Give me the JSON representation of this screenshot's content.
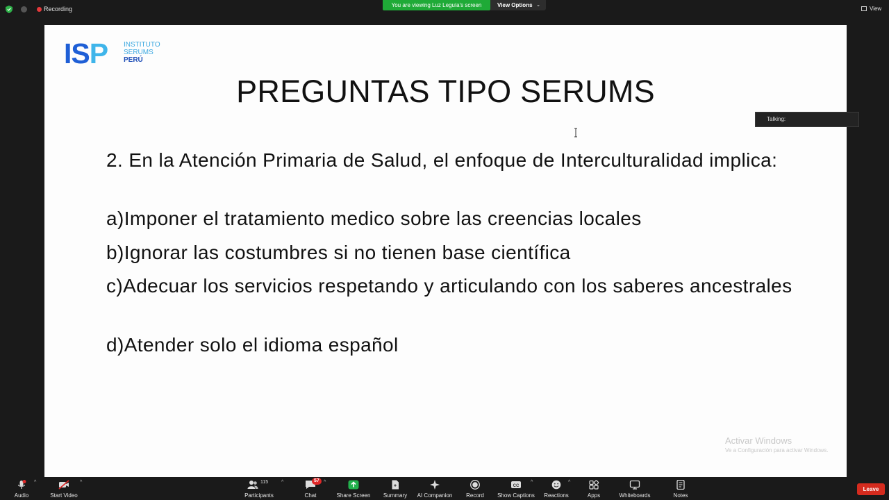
{
  "topbar": {
    "recording_label": "Recording",
    "viewing_banner": "You are viewing Luz Leguía's screen",
    "view_options_label": "View Options",
    "view_label": "View"
  },
  "slide": {
    "logo_text_main": "ISP",
    "logo_line1": "INSTITUTO",
    "logo_line2": "SERUMS",
    "logo_line3": "PERÚ",
    "title": "PREGUNTAS TIPO SERUMS",
    "question": "2. En la Atención Primaria de Salud, el enfoque de Interculturalidad implica:",
    "options": [
      "a)Imponer el tratamiento medico sobre las creencias locales",
      "b)Ignorar las costumbres si no tienen base científica",
      "c)Adecuar los servicios respetando y articulando con los saberes ancestrales",
      "d)Atender solo el idioma español"
    ],
    "watermark_title": "Activar Windows",
    "watermark_sub": "Ve a Configuración para activar Windows."
  },
  "talking": {
    "label": "Talking:"
  },
  "toolbar": {
    "audio": "Audio",
    "start_video": "Start Video",
    "participants": "Participants",
    "participants_count": "115",
    "chat": "Chat",
    "chat_badge": "57",
    "share_screen": "Share Screen",
    "summary": "Summary",
    "ai_companion": "AI Companion",
    "record": "Record",
    "show_captions": "Show Captions",
    "reactions": "Reactions",
    "apps": "Apps",
    "whiteboards": "Whiteboards",
    "notes": "Notes",
    "leave": "Leave"
  },
  "colors": {
    "banner_green": "#1faa37",
    "leave_red": "#d52b1e",
    "share_green": "#22b14c",
    "logo_dark_blue": "#1f5fd6",
    "logo_light_blue": "#3fb5ea"
  }
}
